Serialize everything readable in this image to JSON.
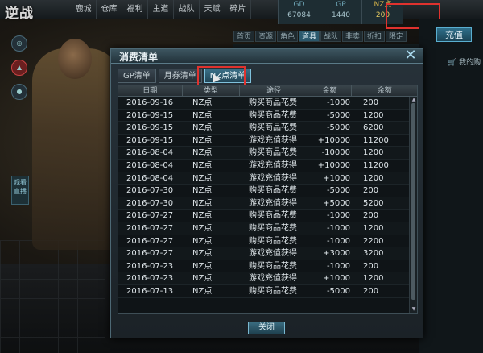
{
  "game": {
    "logo": "逆战"
  },
  "nav": [
    "鹿城",
    "仓库",
    "福利",
    "主道",
    "战队",
    "天赋",
    "碎片"
  ],
  "stats": [
    {
      "label": "GD",
      "value": "67084"
    },
    {
      "label": "GP",
      "value": "1440"
    },
    {
      "label": "NZ点",
      "value": "200"
    }
  ],
  "charge_label": "充值",
  "shop_tabs": [
    "首页",
    "资源",
    "角色",
    "道具",
    "战队",
    "非卖品",
    "折扣",
    "限定"
  ],
  "shop_tab_active": 3,
  "cart_label": "我的购",
  "side": {
    "live_label": "观看直播"
  },
  "dialog": {
    "title": "消费清单",
    "tabs": [
      "GP清单",
      "月券清单",
      "NZ点清单"
    ],
    "active_tab": 2,
    "columns": [
      "日期",
      "类型",
      "途径",
      "金额",
      "余额"
    ],
    "rows": [
      [
        "2016-09-16",
        "NZ点",
        "购买商品花费",
        "-1000",
        "200"
      ],
      [
        "2016-09-15",
        "NZ点",
        "购买商品花费",
        "-5000",
        "1200"
      ],
      [
        "2016-09-15",
        "NZ点",
        "购买商品花费",
        "-5000",
        "6200"
      ],
      [
        "2016-09-15",
        "NZ点",
        "游戏充值获得",
        "+10000",
        "11200"
      ],
      [
        "2016-08-04",
        "NZ点",
        "购买商品花费",
        "-10000",
        "1200"
      ],
      [
        "2016-08-04",
        "NZ点",
        "游戏充值获得",
        "+10000",
        "11200"
      ],
      [
        "2016-08-04",
        "NZ点",
        "游戏充值获得",
        "+1000",
        "1200"
      ],
      [
        "2016-07-30",
        "NZ点",
        "购买商品花费",
        "-5000",
        "200"
      ],
      [
        "2016-07-30",
        "NZ点",
        "游戏充值获得",
        "+5000",
        "5200"
      ],
      [
        "2016-07-27",
        "NZ点",
        "购买商品花费",
        "-1000",
        "200"
      ],
      [
        "2016-07-27",
        "NZ点",
        "购买商品花费",
        "-1000",
        "1200"
      ],
      [
        "2016-07-27",
        "NZ点",
        "购买商品花费",
        "-1000",
        "2200"
      ],
      [
        "2016-07-27",
        "NZ点",
        "游戏充值获得",
        "+3000",
        "3200"
      ],
      [
        "2016-07-23",
        "NZ点",
        "购买商品花费",
        "-1000",
        "200"
      ],
      [
        "2016-07-23",
        "NZ点",
        "游戏充值获得",
        "+1000",
        "1200"
      ],
      [
        "2016-07-13",
        "NZ点",
        "购买商品花费",
        "-5000",
        "200"
      ]
    ],
    "close_label": "关闭"
  },
  "colors": {
    "highlight": "#e0322e",
    "accent": "#7fc1dc",
    "nz_gold": "#e2c860"
  }
}
